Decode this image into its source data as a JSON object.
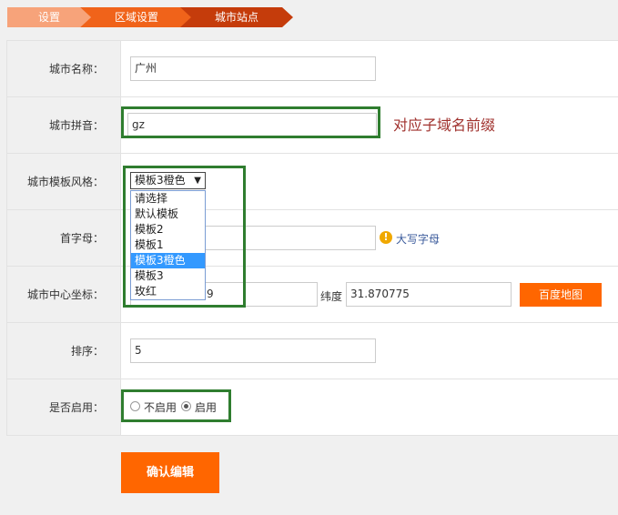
{
  "breadcrumb": {
    "items": [
      {
        "label": "设置",
        "color": "#f7a37a"
      },
      {
        "label": "区域设置",
        "color": "#f0631a"
      },
      {
        "label": "城市站点",
        "color": "#c53c0b"
      }
    ]
  },
  "form": {
    "city_name": {
      "label": "城市名称：",
      "value": "广州"
    },
    "city_pinyin": {
      "label": "城市拼音：",
      "value": "gz",
      "annotation": "对应子域名前缀"
    },
    "template_style": {
      "label": "城市模板风格：",
      "selected": "模板3橙色",
      "options": [
        "请选择",
        "默认模板",
        "模板2",
        "模板1",
        "模板3橙色",
        "模板3",
        "玫红"
      ],
      "highlighted_index": 4
    },
    "initial_letter": {
      "label": "首字母：",
      "value": "",
      "hint": "大写字母"
    },
    "center_coords": {
      "label": "城市中心坐标：",
      "longitude_visible": "9",
      "latitude_label": "纬度",
      "latitude": "31.870775",
      "map_button": "百度地图"
    },
    "sort": {
      "label": "排序：",
      "value": "5"
    },
    "enabled": {
      "label": "是否启用：",
      "options": [
        "不启用",
        "启用"
      ],
      "selected": "启用"
    }
  },
  "submit": {
    "label": "确认编辑"
  },
  "colors": {
    "accent": "#ff6600",
    "highlight_box": "#2f7d2f",
    "annotation": "#a0322e"
  }
}
